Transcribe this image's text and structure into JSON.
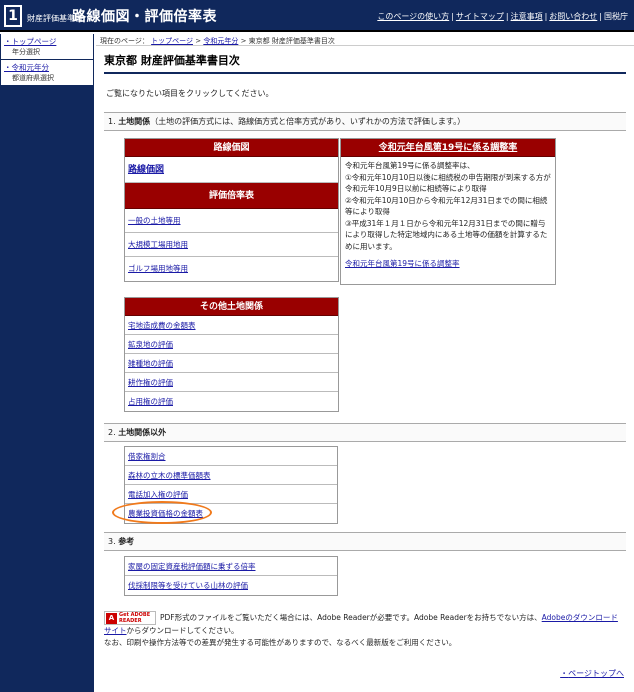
{
  "header": {
    "logo_num": "1",
    "subtitle": "財産評価基準書",
    "title": "路線価図・評価倍率表",
    "nav": [
      "このページの使い方",
      "サイトマップ",
      "注意事項",
      "お問い合わせ"
    ],
    "agency": "国税庁"
  },
  "sidebar": {
    "items": [
      {
        "label": "トップページ",
        "sub": "年分選択"
      },
      {
        "label": "令和元年分",
        "sub": "都道府県選択"
      }
    ]
  },
  "breadcrumb": {
    "prefix": "現在のページ：",
    "links": [
      "トップページ",
      "令和元年分"
    ],
    "current": "東京都 財産評価基準書目次",
    "sep": ">"
  },
  "page": {
    "title": "東京都 財産評価基準書目次",
    "intro": "ご覧になりたい項目をクリックしてください。"
  },
  "section1": {
    "num": "1.",
    "title": "土地関係",
    "note": "（土地の評価方式には、路線価方式と倍率方式があり、いずれかの方法で評価します。）",
    "rosenka_head": "路線価図",
    "rosenka_link": "路線価図",
    "bairitsu_head": "評価倍率表",
    "bairitsu_links": [
      "一般の土地等用",
      "大規模工場用地用",
      "ゴルフ場用地等用"
    ],
    "typhoon_head": "令和元年台風第19号に係る調整率",
    "typhoon_lines": [
      "令和元年台風第19号に係る調整率は、",
      "①令和元年10月10日以後に相続税の申告期限が到来する方が令和元年10月9日以前に相続等により取得",
      "②令和元年10月10日から令和元年12月31日までの間に相続等により取得",
      "③平成31年１月１日から令和元年12月31日までの間に贈与により取得した特定地域内にある土地等の価額を計算するために用います。"
    ],
    "typhoon_link": "令和元年台風第19号に係る調整率",
    "other_head": "その他土地関係",
    "other_links": [
      "宅地造成費の金額表",
      "鉱泉地の評価",
      "雑種地の評価",
      "耕作権の評価",
      "占用権の評価"
    ]
  },
  "section2": {
    "num": "2.",
    "title": "土地関係以外",
    "links": [
      "借家権割合",
      "森林の立木の標準価額表",
      "電話加入権の評価",
      "農業投資価格の金額表"
    ]
  },
  "section3": {
    "num": "3.",
    "title": "参考",
    "links": [
      "家屋の固定資産税評価額に乗ずる倍率",
      "伐採制限等を受けている山林の評価"
    ]
  },
  "footer": {
    "badge_text": "Get ADOBE READER",
    "note_before": "PDF形式のファイルをご覧いただく場合には、Adobe Readerが必要です。Adobe Readerをお持ちでない方は、",
    "note_link": "Adobeのダウンロードサイト",
    "note_after": "からダウンロードしてください。",
    "note2": "なお、印刷や操作方法等での差異が発生する可能性がありますので、なるべく最新版をご利用ください。",
    "page_top": "ページトップへ"
  },
  "colors": {
    "navy": "#10285c",
    "crimson": "#990000",
    "highlight": "#f07a1c"
  }
}
